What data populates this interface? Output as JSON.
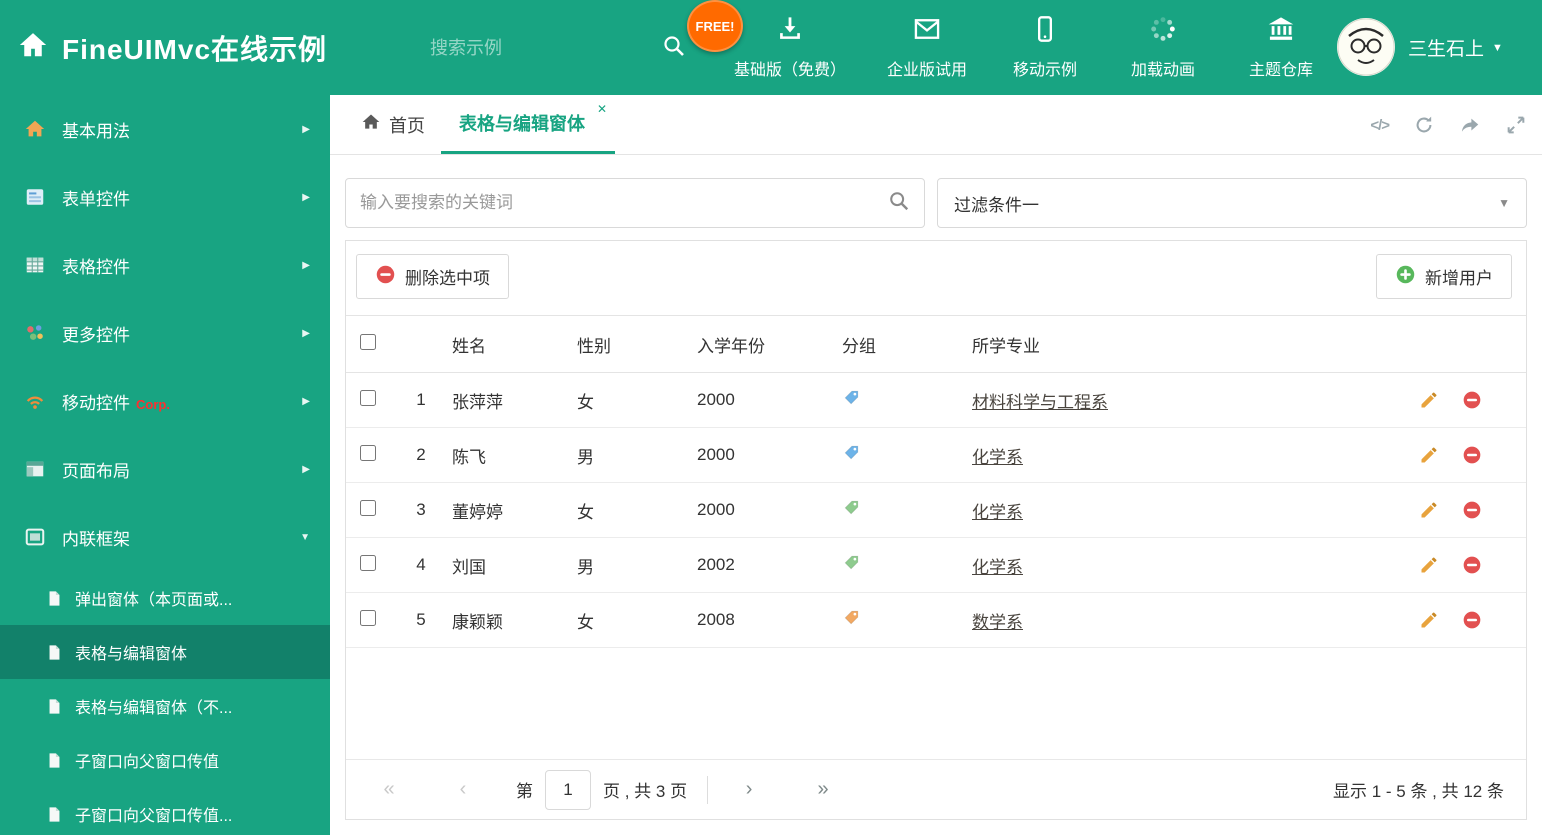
{
  "icons": {
    "chevron_right": "▶",
    "chevron_down": "▼",
    "caret_down": "▼",
    "close": "✕",
    "code": "</>",
    "pager_first": "«",
    "pager_prev": "‹",
    "pager_next": "›",
    "pager_last": "»"
  },
  "colors": {
    "theme": "#18a482",
    "danger": "#e25050",
    "success": "#58b85c",
    "free_badge": "#ff6a00"
  },
  "header": {
    "title": "FineUIMvc在线示例",
    "search_placeholder": "搜索示例",
    "free_badge": "FREE!",
    "nav": [
      {
        "label": "基础版（免费）"
      },
      {
        "label": "企业版试用"
      },
      {
        "label": "移动示例"
      },
      {
        "label": "加载动画"
      },
      {
        "label": "主题仓库"
      }
    ],
    "username": "三生石上"
  },
  "sidebar": {
    "items": [
      {
        "label": "基本用法"
      },
      {
        "label": "表单控件"
      },
      {
        "label": "表格控件"
      },
      {
        "label": "更多控件"
      },
      {
        "label": "移动控件",
        "tag": "Corp."
      },
      {
        "label": "页面布局"
      },
      {
        "label": "内联框架"
      }
    ],
    "subitems": [
      {
        "label": "弹出窗体（本页面或..."
      },
      {
        "label": "表格与编辑窗体"
      },
      {
        "label": "表格与编辑窗体（不..."
      },
      {
        "label": "子窗口向父窗口传值"
      },
      {
        "label": "子窗口向父窗口传值..."
      }
    ]
  },
  "tabs": {
    "home": "首页",
    "active": "表格与编辑窗体"
  },
  "filters": {
    "search_placeholder": "输入要搜索的关键词",
    "filter_value": "过滤条件一"
  },
  "toolbar": {
    "delete_label": "删除选中项",
    "add_label": "新增用户"
  },
  "table": {
    "headers": {
      "name": "姓名",
      "gender": "性别",
      "year": "入学年份",
      "group": "分组",
      "major": "所学专业"
    },
    "rows": [
      {
        "num": "1",
        "name": "张萍萍",
        "gender": "女",
        "year": "2000",
        "tag_color": "#6db3e8",
        "major": "材料科学与工程系"
      },
      {
        "num": "2",
        "name": "陈飞",
        "gender": "男",
        "year": "2000",
        "tag_color": "#6db3e8",
        "major": "化学系"
      },
      {
        "num": "3",
        "name": "董婷婷",
        "gender": "女",
        "year": "2000",
        "tag_color": "#8ecb8e",
        "major": "化学系"
      },
      {
        "num": "4",
        "name": "刘国",
        "gender": "男",
        "year": "2002",
        "tag_color": "#8ecb8e",
        "major": "化学系"
      },
      {
        "num": "5",
        "name": "康颖颖",
        "gender": "女",
        "year": "2008",
        "tag_color": "#f2a963",
        "major": "数学系"
      }
    ]
  },
  "pagination": {
    "page_prefix": "第",
    "current_page": "1",
    "page_suffix": "页 , 共 3 页",
    "summary": "显示 1 - 5 条 , 共 12 条"
  }
}
